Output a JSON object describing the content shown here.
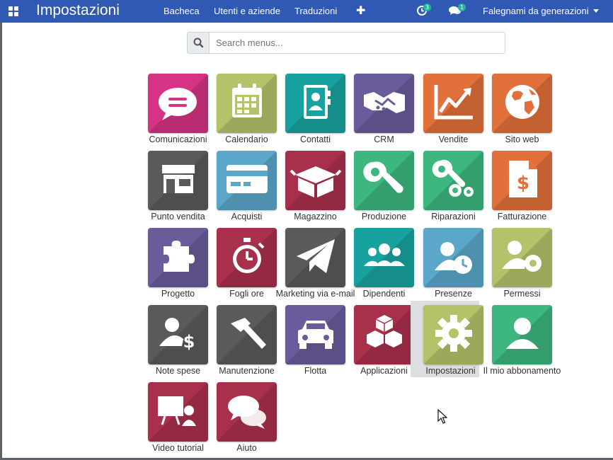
{
  "navbar": {
    "title": "Impostazioni",
    "menus": [
      "Bacheca",
      "Utenti e aziende",
      "Traduzioni"
    ],
    "plus_icon": "plus-icon",
    "activity_count": "3",
    "messages_count": "1",
    "company": "Falegnami da generazioni",
    "bg_color": "#2f59b3"
  },
  "search": {
    "placeholder": "Search menus..."
  },
  "apps": [
    {
      "label": "Comunicazioni",
      "icon": "chat-bubble-icon",
      "color": "#d63384"
    },
    {
      "label": "Calendario",
      "icon": "calendar-icon",
      "color": "#b5c26a"
    },
    {
      "label": "Contatti",
      "icon": "address-book-icon",
      "color": "#17a2a0"
    },
    {
      "label": "CRM",
      "icon": "handshake-icon",
      "color": "#6a5b9a"
    },
    {
      "label": "Vendite",
      "icon": "line-chart-icon",
      "color": "#e2703a"
    },
    {
      "label": "Sito web",
      "icon": "globe-icon",
      "color": "#e2703a"
    },
    {
      "label": "Punto vendita",
      "icon": "shop-icon",
      "color": "#5a5a5a"
    },
    {
      "label": "Acquisti",
      "icon": "credit-card-icon",
      "color": "#5aa7c9"
    },
    {
      "label": "Magazzino",
      "icon": "box-icon",
      "color": "#a9304c"
    },
    {
      "label": "Produzione",
      "icon": "wrench-icon",
      "color": "#3db67f"
    },
    {
      "label": "Riparazioni",
      "icon": "wrench-gear-icon",
      "color": "#3db67f"
    },
    {
      "label": "Fatturazione",
      "icon": "invoice-icon",
      "color": "#e2703a"
    },
    {
      "label": "Progetto",
      "icon": "puzzle-icon",
      "color": "#6a5b9a"
    },
    {
      "label": "Fogli ore",
      "icon": "stopwatch-icon",
      "color": "#a9304c"
    },
    {
      "label": "Marketing via e-mail",
      "icon": "paper-plane-icon",
      "color": "#5a5a5a"
    },
    {
      "label": "Dipendenti",
      "icon": "users-icon",
      "color": "#17a2a0"
    },
    {
      "label": "Presenze",
      "icon": "user-clock-icon",
      "color": "#5aa7c9"
    },
    {
      "label": "Permessi",
      "icon": "user-gear-icon",
      "color": "#b5c26a"
    },
    {
      "label": "Note spese",
      "icon": "user-dollar-icon",
      "color": "#5a5a5a"
    },
    {
      "label": "Manutenzione",
      "icon": "hammer-icon",
      "color": "#5a5a5a"
    },
    {
      "label": "Flotta",
      "icon": "car-icon",
      "color": "#6a5b9a"
    },
    {
      "label": "Applicazioni",
      "icon": "cubes-icon",
      "color": "#a9304c"
    },
    {
      "label": "Impostazioni",
      "icon": "gear-icon",
      "color": "#b5c26a"
    },
    {
      "label": "Il mio abbonamento",
      "icon": "user-icon",
      "color": "#3db67f"
    },
    {
      "label": "Video tutorial",
      "icon": "presentation-icon",
      "color": "#a9304c"
    },
    {
      "label": "Aiuto",
      "icon": "chat-bubbles-icon",
      "color": "#a9304c"
    }
  ]
}
